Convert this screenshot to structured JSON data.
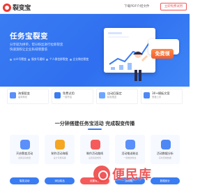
{
  "header": {
    "logo_text": "裂变宝",
    "download_link": "下载PDF介绍文件",
    "cta_button": "立即免费试用"
  },
  "hero": {
    "title": "任务宝裂变",
    "subtitle_line1": "分享就为拼单，帮分粉丝进行拉新裂变",
    "subtitle_line2": "快速涨粉让企业私域增量倍",
    "features": [
      "公众号裂变",
      "服务号通知",
      "个人微信群裂变",
      "企业微信裂变"
    ],
    "badge": "免费领"
  },
  "cards": [
    {
      "title": "海报裂变",
      "desc": "高效转化",
      "color": "#5b8ff9",
      "icon": "poster-icon"
    },
    {
      "title": "免费试用",
      "desc": "一键开启",
      "color": "#3a7cf2",
      "icon": "gift-icon"
    },
    {
      "title": "自动回复定",
      "desc": "精准推送",
      "color": "#6da6ff",
      "icon": "reply-icon"
    },
    {
      "title": "30+模板文案",
      "desc": "快速上手",
      "color": "#4e88f5",
      "icon": "template-icon"
    }
  ],
  "section": {
    "title": "一分钟搭建任务宝活动 完成裂变传播"
  },
  "steps": [
    {
      "title": "开启裂变活动",
      "desc": "选择活动类型",
      "color": "#5b8ff9",
      "icon": "play-icon"
    },
    {
      "title": "制作活动海报",
      "desc": "设计专属海报",
      "color": "#f5a623",
      "icon": "image-icon"
    },
    {
      "title": "制作活动路线",
      "desc": "设置奖励规则",
      "color": "#f55b5b",
      "icon": "route-icon"
    },
    {
      "title": "活动推送粉丝",
      "desc": "一键推送粉丝",
      "color": "#5b8ff9",
      "icon": "send-icon"
    },
    {
      "title": "活动数据分析",
      "desc": "实时查看数据",
      "color": "#4e88f5",
      "icon": "chart-icon"
    }
  ],
  "flow": [
    "裂变活动",
    "添加奖品",
    "设置海报",
    "活动推广",
    "数据统计"
  ],
  "watermark": "便民库"
}
